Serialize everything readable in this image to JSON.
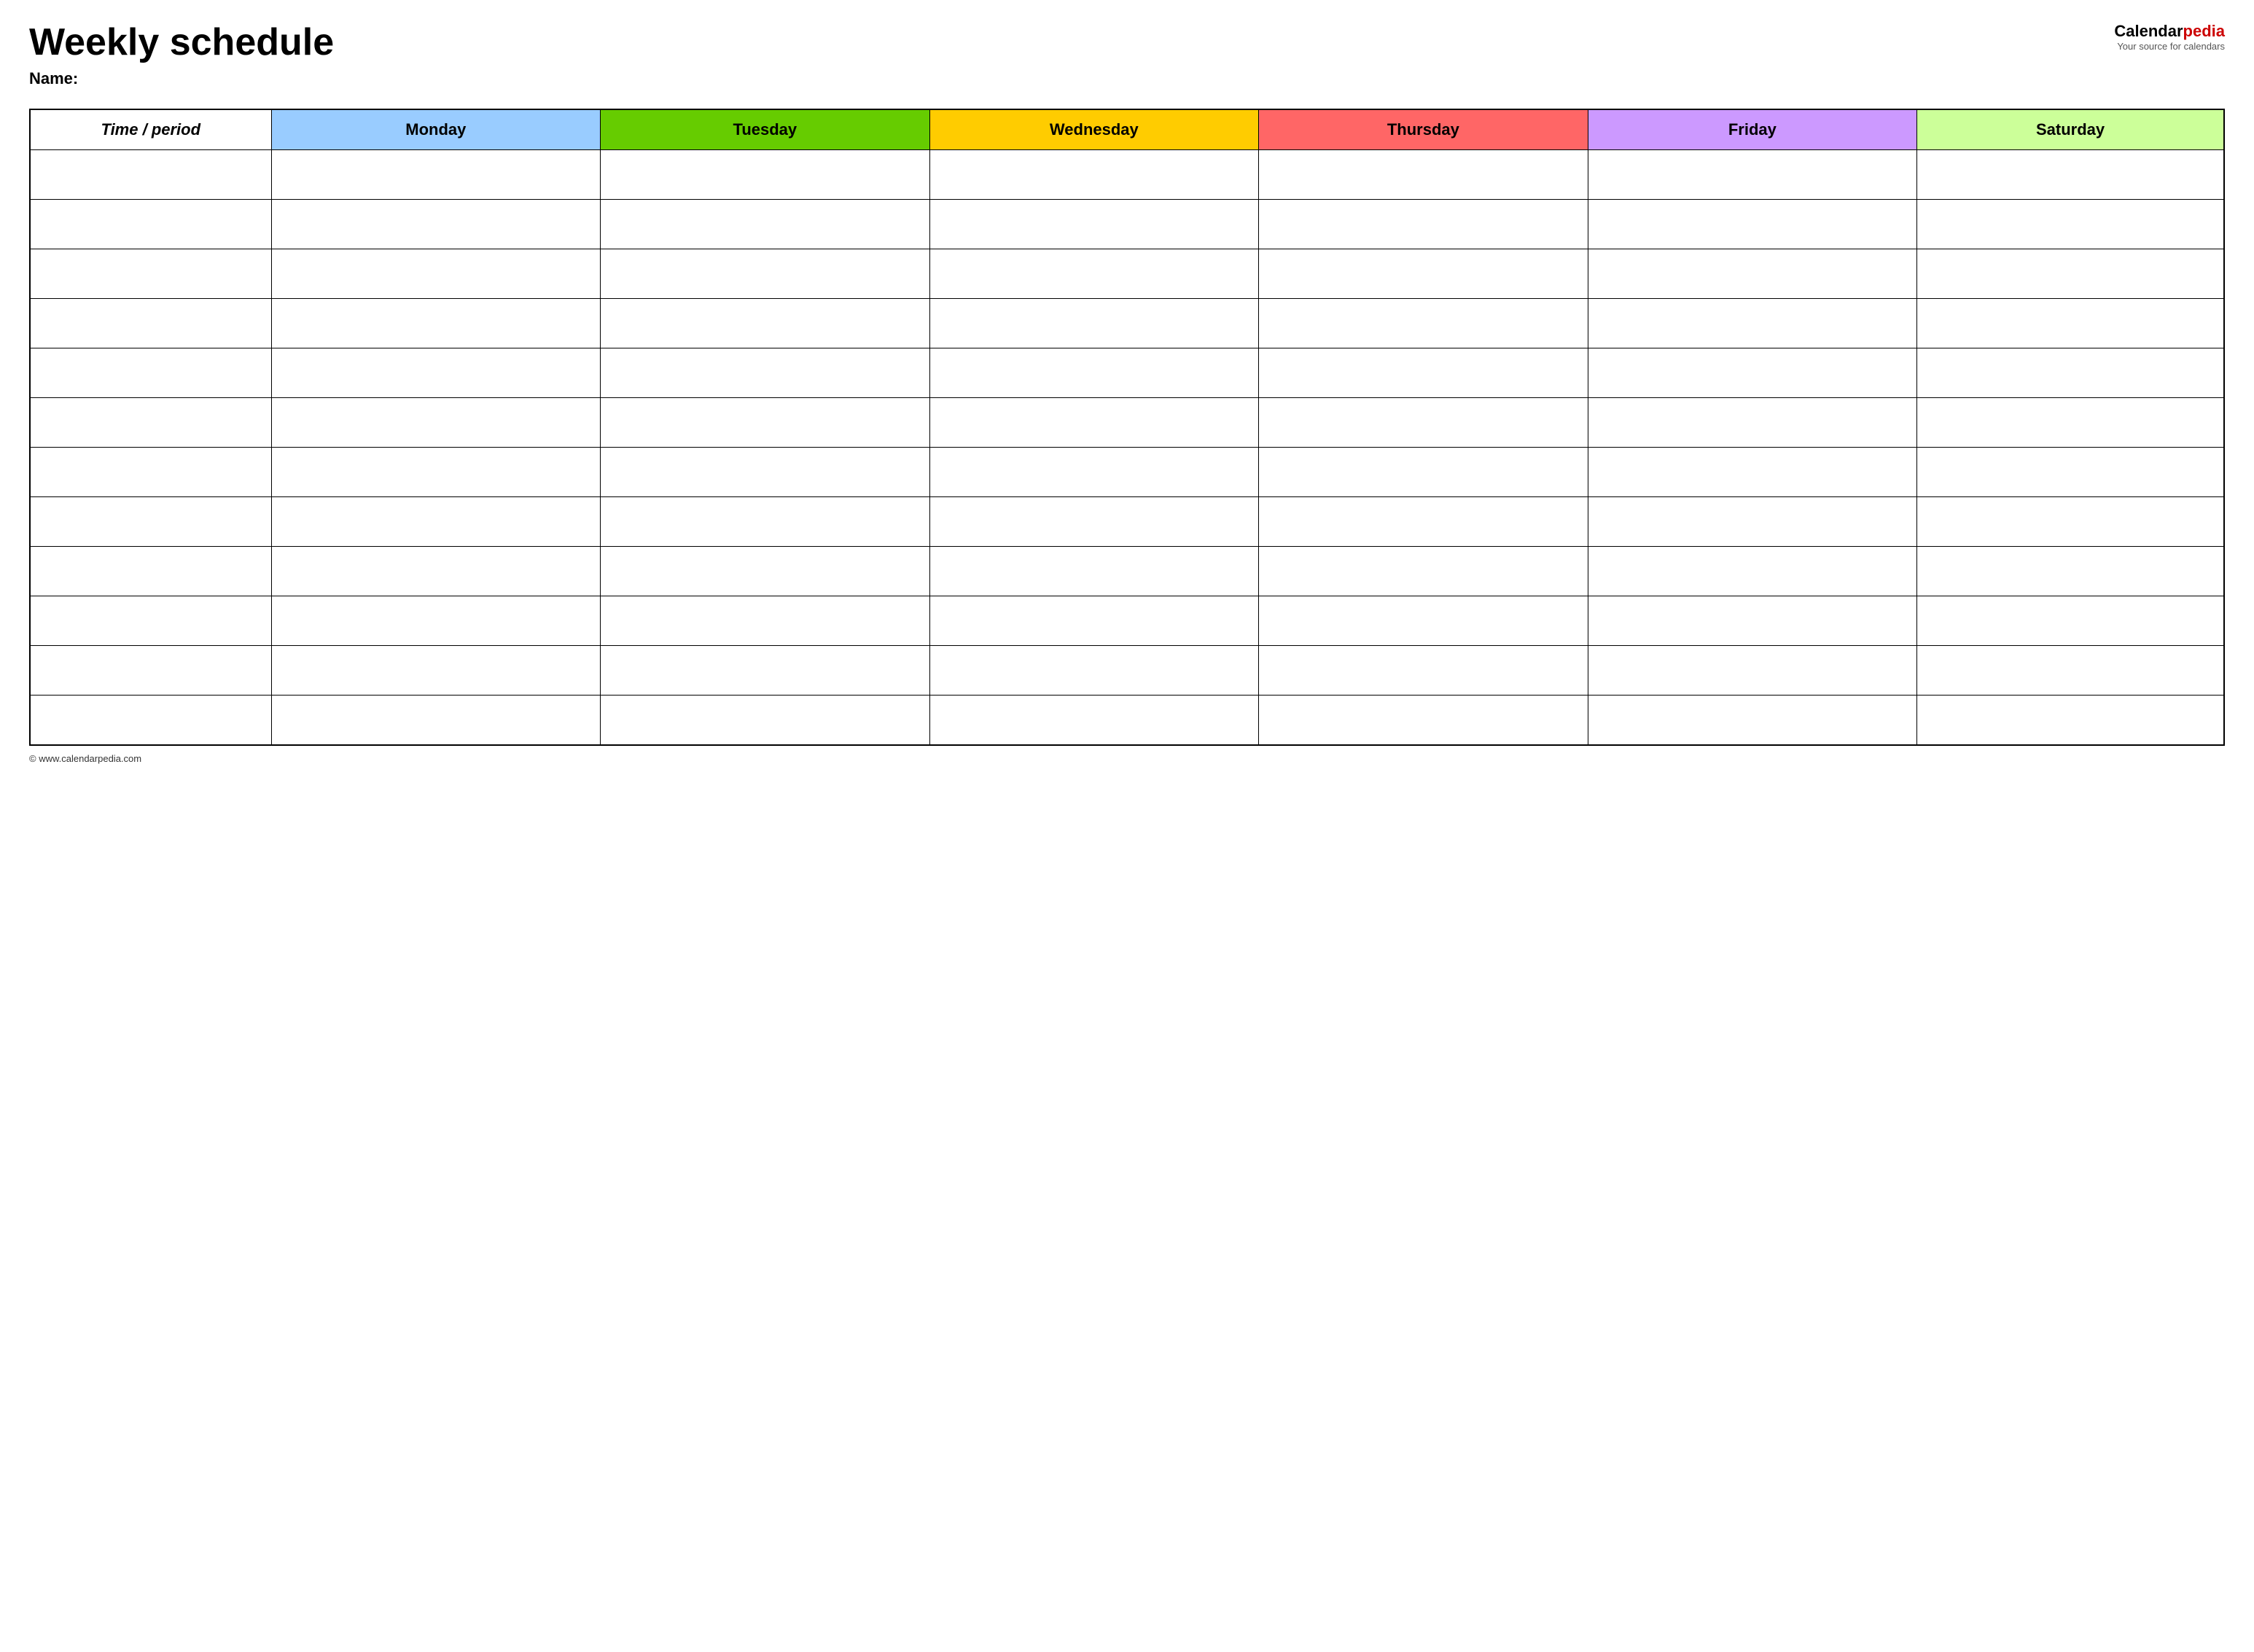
{
  "header": {
    "title": "Weekly schedule",
    "name_label": "Name:",
    "logo_calendar": "Calendar",
    "logo_pedia": "pedia",
    "logo_subtitle": "Your source for calendars"
  },
  "table": {
    "columns": [
      {
        "key": "time",
        "label": "Time / period",
        "class": "col-time"
      },
      {
        "key": "monday",
        "label": "Monday",
        "class": "col-monday"
      },
      {
        "key": "tuesday",
        "label": "Tuesday",
        "class": "col-tuesday"
      },
      {
        "key": "wednesday",
        "label": "Wednesday",
        "class": "col-wednesday"
      },
      {
        "key": "thursday",
        "label": "Thursday",
        "class": "col-thursday"
      },
      {
        "key": "friday",
        "label": "Friday",
        "class": "col-friday"
      },
      {
        "key": "saturday",
        "label": "Saturday",
        "class": "col-saturday"
      }
    ],
    "row_count": 12
  },
  "footer": {
    "url": "© www.calendarpedia.com"
  }
}
